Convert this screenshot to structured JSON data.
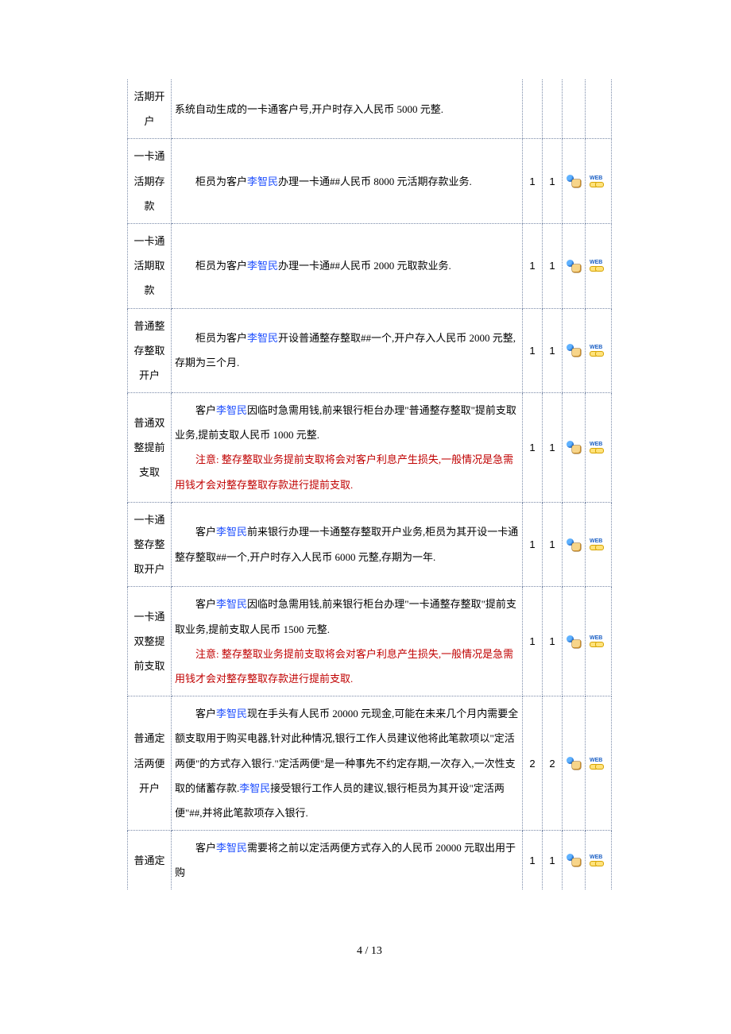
{
  "footer": "4 / 13",
  "customer_name": "李智民",
  "rows": [
    {
      "title": "活期开户",
      "desc_prefix": "系统自动生成的一卡通客户号,开户时存入人民币 5000 元整.",
      "name_in_desc": null,
      "desc_suffix": null,
      "note": null,
      "col1": "",
      "col2": "",
      "has_icons": false,
      "continued_top": true
    },
    {
      "title": "一卡通活期存款",
      "desc_prefix": "柜员为客户",
      "name_in_desc": "李智民",
      "desc_suffix": "办理一卡通##人民币 8000 元活期存款业务.",
      "note": null,
      "col1": "1",
      "col2": "1",
      "has_icons": true
    },
    {
      "title": "一卡通活期取款",
      "desc_prefix": "柜员为客户",
      "name_in_desc": "李智民",
      "desc_suffix": "办理一卡通##人民币 2000 元取款业务.",
      "note": null,
      "col1": "1",
      "col2": "1",
      "has_icons": true
    },
    {
      "title": "普通整存整取开户",
      "desc_prefix": "柜员为客户",
      "name_in_desc": "李智民",
      "desc_suffix": "开设普通整存整取##一个,开户存入人民币 2000 元整,存期为三个月.",
      "note": null,
      "col1": "1",
      "col2": "1",
      "has_icons": true
    },
    {
      "title": "普通双整提前支取",
      "desc_prefix": "客户",
      "name_in_desc": "李智民",
      "desc_suffix": "因临时急需用钱,前来银行柜台办理\"普通整存整取\"提前支取业务,提前支取人民币 1000 元整.",
      "note": "注意: 整存整取业务提前支取将会对客户利息产生损失,一般情况是急需用钱才会对整存整取存款进行提前支取.",
      "col1": "1",
      "col2": "1",
      "has_icons": true
    },
    {
      "title": "一卡通整存整取开户",
      "desc_prefix": "客户",
      "name_in_desc": "李智民",
      "desc_suffix": "前来银行办理一卡通整存整取开户业务,柜员为其开设一卡通整存整取##一个,开户时存入人民币 6000 元整,存期为一年.",
      "note": null,
      "col1": "1",
      "col2": "1",
      "has_icons": true
    },
    {
      "title": "一卡通双整提前支取",
      "desc_prefix": "客户",
      "name_in_desc": "李智民",
      "desc_suffix": "因临时急需用钱,前来银行柜台办理\"一卡通整存整取\"提前支取业务,提前支取人民币 1500 元整.",
      "note": "注意: 整存整取业务提前支取将会对客户利息产生损失,一般情况是急需用钱才会对整存整取存款进行提前支取.",
      "col1": "1",
      "col2": "1",
      "has_icons": true
    },
    {
      "title": "普通定活两便开户",
      "desc_prefix": "客户",
      "name_in_desc": "李智民",
      "desc_suffix": "现在手头有人民币 20000 元现金,可能在未来几个月内需要全额支取用于购买电器,针对此种情况,银行工作人员建议他将此笔款项以\"定活两便\"的方式存入银行.\"定活两便\"是一种事先不约定存期,一次存入,一次性支取的储蓄存款.",
      "name2": "李智民",
      "desc_suffix2": "接受银行工作人员的建议,银行柜员为其开设\"定活两便\"##,并将此笔款项存入银行.",
      "note": null,
      "col1": "2",
      "col2": "2",
      "has_icons": true
    },
    {
      "title": "普通定",
      "desc_prefix": "客户",
      "name_in_desc": "李智民",
      "desc_suffix": "需要将之前以定活两便方式存入的人民币 20000 元取出用于购",
      "note": null,
      "col1": "1",
      "col2": "1",
      "has_icons": true,
      "continued_bottom": true
    }
  ]
}
